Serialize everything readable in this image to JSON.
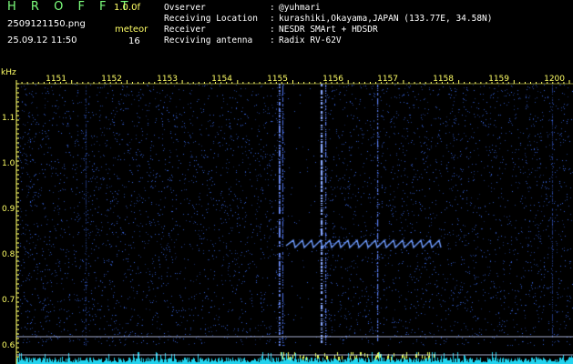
{
  "app": {
    "title": "H R O F F T",
    "version": "1.0.0f"
  },
  "file_name": "2509121150.png",
  "date_time": "25.09.12 11:50",
  "mode": {
    "label": "meteor",
    "count": "16"
  },
  "info": [
    {
      "key": "Ovserver",
      "value": "@yuhmari"
    },
    {
      "key": "Receiving Location",
      "value": "kurashiki,Okayama,JAPAN (133.77E, 34.58N)"
    },
    {
      "key": "Receiver",
      "value": "NESDR SMArt + HDSDR"
    },
    {
      "key": "Recviving antenna",
      "value": "Radix RV-62V"
    }
  ],
  "axis": {
    "unit_label": "kHz",
    "x_ticks": [
      "1151",
      "1152",
      "1153",
      "1154",
      "1155",
      "1156",
      "1157",
      "1158",
      "1159",
      "1200"
    ],
    "y_ticks": [
      "1.1",
      "1.0",
      "0.9",
      "0.8",
      "0.7",
      "0.6"
    ]
  },
  "colors": {
    "tick_text": "#ffff66",
    "noise": "#1a3aa8",
    "signal_line": "#7fa6ff",
    "meteor": "#6f9cff",
    "baseline": "#22d3ee",
    "guide_line": "#d0d8ff"
  }
}
